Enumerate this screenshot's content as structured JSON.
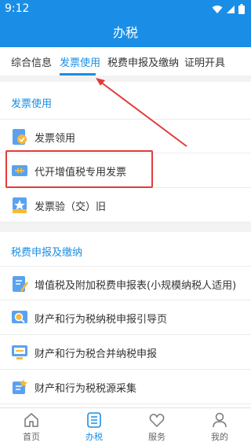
{
  "status_bar": {
    "time": "9:12"
  },
  "header": {
    "title": "办税"
  },
  "tabs": [
    {
      "label": "综合信息"
    },
    {
      "label": "发票使用"
    },
    {
      "label": "税费申报及缴纳"
    },
    {
      "label": "证明开具"
    }
  ],
  "sections": [
    {
      "title": "发票使用",
      "items": [
        {
          "label": "发票领用",
          "icon": "invoice-check-icon"
        },
        {
          "label": "代开增值税专用发票",
          "icon": "invoice-issue-icon"
        },
        {
          "label": "发票验（交）旧",
          "icon": "invoice-star-icon"
        }
      ]
    },
    {
      "title": "税费申报及缴纳",
      "items": [
        {
          "label": "增值税及附加税费申报表(小规模纳税人适用)",
          "icon": "form-edit-icon"
        },
        {
          "label": "财产和行为税纳税申报引导页",
          "icon": "search-doc-icon"
        },
        {
          "label": "财产和行为税合并纳税申报",
          "icon": "monitor-icon"
        },
        {
          "label": "财产和行为税税源采集",
          "icon": "collect-icon"
        }
      ]
    }
  ],
  "bottom_nav": [
    {
      "label": "首页",
      "icon": "home-icon"
    },
    {
      "label": "办税",
      "icon": "list-icon",
      "active": true
    },
    {
      "label": "服务",
      "icon": "heart-icon"
    },
    {
      "label": "我的",
      "icon": "user-icon"
    }
  ],
  "colors": {
    "brand": "#1a8ee6",
    "highlight": "#e23b3b"
  }
}
